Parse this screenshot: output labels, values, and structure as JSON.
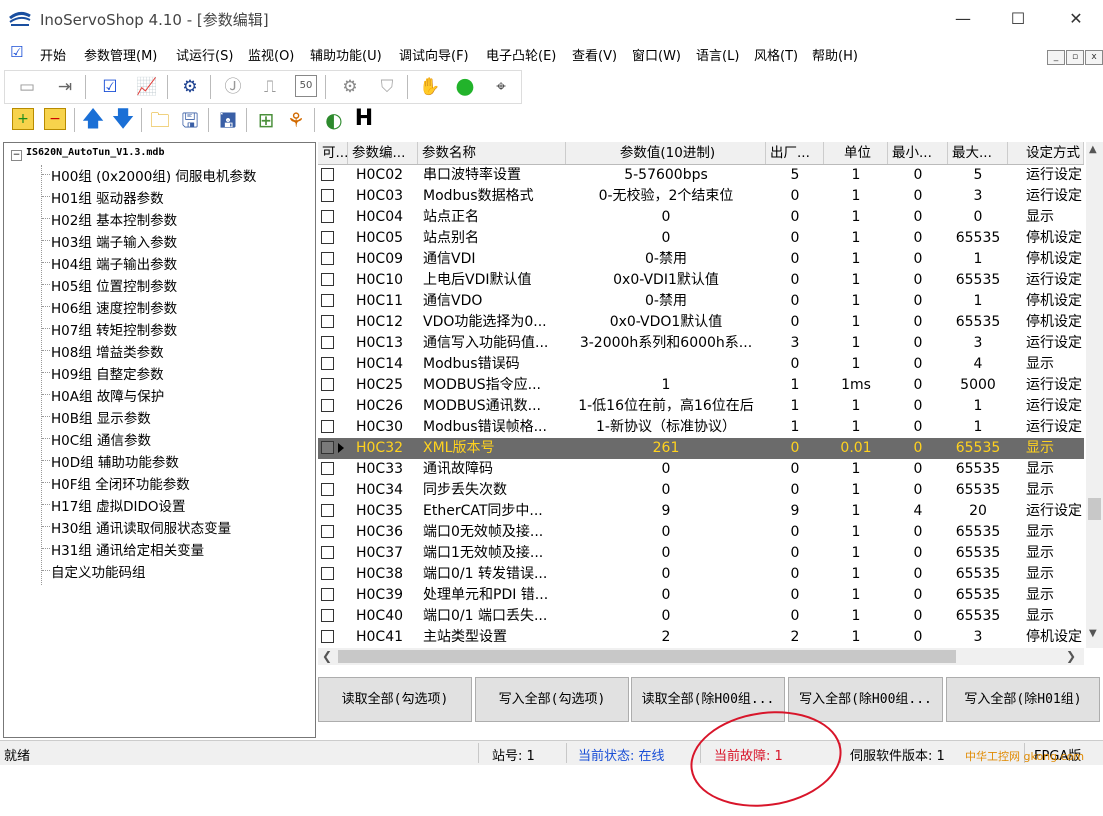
{
  "window": {
    "title": "InoServoShop 4.10 - [参数编辑]",
    "minimize": "—",
    "maximize": "☐",
    "close": "✕"
  },
  "menu": [
    "开始",
    "参数管理(M)",
    "试运行(S)",
    "监视(O)",
    "辅助功能(U)",
    "调试向导(F)",
    "电子凸轮(E)",
    "查看(V)",
    "窗口(W)",
    "语言(L)",
    "风格(T)",
    "帮助(H)"
  ],
  "mdi": {
    "minimize": "_",
    "restore": "▫",
    "close": "x"
  },
  "toolbar2_h": "H",
  "tree": {
    "root": "IS620N_AutoTun_V1.3.mdb",
    "items": [
      "H00组 (0x2000组) 伺服电机参数",
      "H01组 驱动器参数",
      "H02组 基本控制参数",
      "H03组 端子输入参数",
      "H04组 端子输出参数",
      "H05组 位置控制参数",
      "H06组 速度控制参数",
      "H07组 转矩控制参数",
      "H08组 增益类参数",
      "H09组 自整定参数",
      "H0A组 故障与保护",
      "H0B组 显示参数",
      "H0C组 通信参数",
      "H0D组 辅助功能参数",
      "H0F组 全闭环功能参数",
      "H17组 虚拟DIDO设置",
      "H30组 通讯读取伺服状态变量",
      "H31组 通讯给定相关变量",
      "自定义功能码组"
    ]
  },
  "grid": {
    "headers": [
      "可...",
      "参数编...",
      "参数名称",
      "参数值(10进制)",
      "出厂...",
      "单位",
      "最小...",
      "最大...",
      "设定方式"
    ],
    "rows": [
      [
        "H0C02",
        "串口波特率设置",
        "5-57600bps",
        "5",
        "1",
        "0",
        "5",
        "运行设定"
      ],
      [
        "H0C03",
        "Modbus数据格式",
        "0-无校验，2个结束位",
        "0",
        "1",
        "0",
        "3",
        "运行设定"
      ],
      [
        "H0C04",
        "站点正名",
        "0",
        "0",
        "1",
        "0",
        "0",
        "显示"
      ],
      [
        "H0C05",
        "站点别名",
        "0",
        "0",
        "1",
        "0",
        "65535",
        "停机设定"
      ],
      [
        "H0C09",
        "通信VDI",
        "0-禁用",
        "0",
        "1",
        "0",
        "1",
        "停机设定"
      ],
      [
        "H0C10",
        "上电后VDI默认值",
        "0x0-VDI1默认值",
        "0",
        "1",
        "0",
        "65535",
        "运行设定"
      ],
      [
        "H0C11",
        "通信VDO",
        "0-禁用",
        "0",
        "1",
        "0",
        "1",
        "停机设定"
      ],
      [
        "H0C12",
        "VDO功能选择为0...",
        "0x0-VDO1默认值",
        "0",
        "1",
        "0",
        "65535",
        "停机设定"
      ],
      [
        "H0C13",
        "通信写入功能码值...",
        "3-2000h系列和6000h系...",
        "3",
        "1",
        "0",
        "3",
        "运行设定"
      ],
      [
        "H0C14",
        "Modbus错误码",
        "",
        "0",
        "1",
        "0",
        "4",
        "显示"
      ],
      [
        "H0C25",
        "MODBUS指令应...",
        "1",
        "1",
        "1ms",
        "0",
        "5000",
        "运行设定"
      ],
      [
        "H0C26",
        "MODBUS通讯数...",
        "1-低16位在前，高16位在后",
        "1",
        "1",
        "0",
        "1",
        "运行设定"
      ],
      [
        "H0C30",
        "Modbus错误帧格...",
        "1-新协议（标准协议）",
        "1",
        "1",
        "0",
        "1",
        "运行设定"
      ],
      [
        "H0C32",
        "XML版本号",
        "261",
        "0",
        "0.01",
        "0",
        "65535",
        "显示"
      ],
      [
        "H0C33",
        "通讯故障码",
        "0",
        "0",
        "1",
        "0",
        "65535",
        "显示"
      ],
      [
        "H0C34",
        "同步丢失次数",
        "0",
        "0",
        "1",
        "0",
        "65535",
        "显示"
      ],
      [
        "H0C35",
        "EtherCAT同步中...",
        "9",
        "9",
        "1",
        "4",
        "20",
        "运行设定"
      ],
      [
        "H0C36",
        "端口0无效帧及接...",
        "0",
        "0",
        "1",
        "0",
        "65535",
        "显示"
      ],
      [
        "H0C37",
        "端口1无效帧及接...",
        "0",
        "0",
        "1",
        "0",
        "65535",
        "显示"
      ],
      [
        "H0C38",
        "端口0/1 转发错误...",
        "0",
        "0",
        "1",
        "0",
        "65535",
        "显示"
      ],
      [
        "H0C39",
        "处理单元和PDI 错...",
        "0",
        "0",
        "1",
        "0",
        "65535",
        "显示"
      ],
      [
        "H0C40",
        "端口0/1 端口丢失...",
        "0",
        "0",
        "1",
        "0",
        "65535",
        "显示"
      ],
      [
        "H0C41",
        "主站类型设置",
        "2",
        "2",
        "1",
        "0",
        "3",
        "停机设定"
      ]
    ],
    "selected_index": 13,
    "selected_color": "#ffd21e"
  },
  "buttons": [
    "读取全部(勾选项)",
    "写入全部(勾选项)",
    "读取全部(除H00组...",
    "写入全部(除H00组...",
    "写入全部(除H01组)"
  ],
  "status": {
    "ready": "就绪",
    "station": "站号: 1",
    "state": "当前状态: 在线",
    "fault": "当前故障: 1",
    "software": "伺服软件版本: 1",
    "fpga": "FPGA版",
    "state_color": "#1a4fd6",
    "fault_color": "#d8152a"
  },
  "watermark": "中华工控网 gkong.com"
}
